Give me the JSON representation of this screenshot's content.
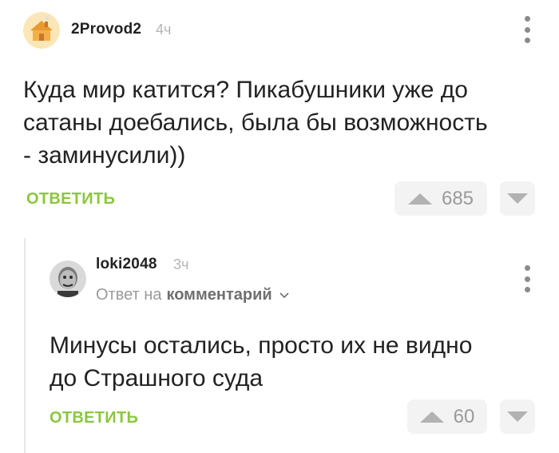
{
  "comments": [
    {
      "username": "2Provod2",
      "time": "4ч",
      "text_lines": [
        "Куда мир катится? Пикабушники уже до",
        "сатаны доебались, была бы возможность",
        "- заминусили))"
      ],
      "reply_label": "ОТВЕТИТЬ",
      "rating": "685"
    },
    {
      "username": "loki2048",
      "time": "3ч",
      "reply_to_prefix": "Ответ на",
      "reply_to_target": "комментарий",
      "text_lines": [
        "Минусы остались, просто их не видно",
        "до Страшного суда"
      ],
      "reply_label": "ОТВЕТИТЬ",
      "rating": "60"
    }
  ],
  "colors": {
    "accent": "#8cc63f",
    "muted": "#9a9a9a",
    "vote_bg": "#f3f3f3"
  },
  "icons": [
    "house-avatar-icon",
    "man-avatar-icon",
    "more-vertical-icon",
    "arrow-up-icon",
    "arrow-down-icon",
    "chevron-down-icon"
  ]
}
